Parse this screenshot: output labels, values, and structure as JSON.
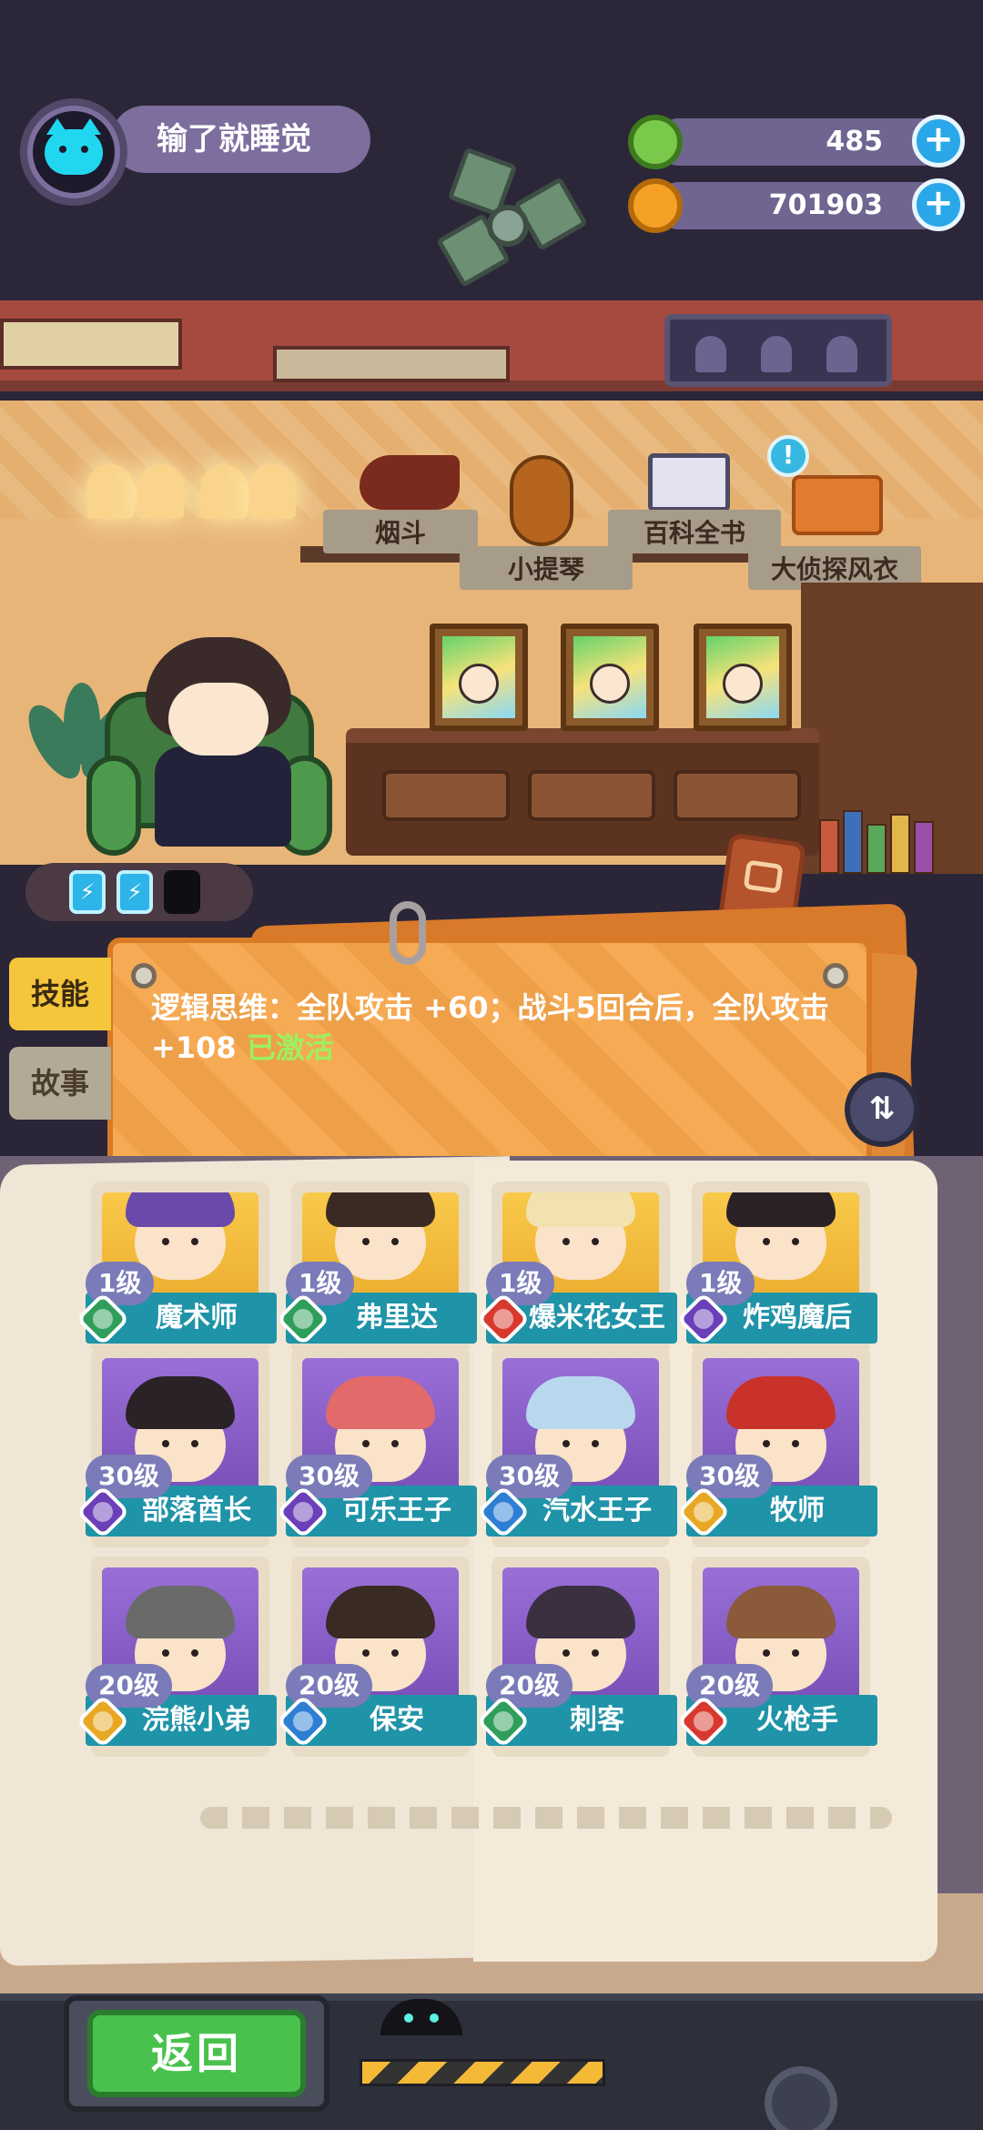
{
  "player": {
    "name": "输了就睡觉",
    "avatar_icon": "cyan-cat-icon"
  },
  "currencies": [
    {
      "name": "green-gem",
      "amount": "485",
      "icon": "green-coin-icon",
      "color": "#7bc94a"
    },
    {
      "name": "gold-coin",
      "amount": "701903",
      "icon": "planet-coin-icon",
      "color": "#f4a126"
    }
  ],
  "plus_symbol": "+",
  "room_items": {
    "pipe": "烟斗",
    "violin": "小提琴",
    "encyclopedia": "百科全书",
    "coat": "大侦探风衣",
    "alert": "!"
  },
  "energy": {
    "filled": 2,
    "total": 3
  },
  "side_tabs": {
    "skill": "技能",
    "story": "故事"
  },
  "skill": {
    "text": "逻辑思维：全队攻击 +60；战斗5回合后，全队攻击 +108",
    "status": "已激活"
  },
  "characters": [
    {
      "level": "1级",
      "name": "魔术师",
      "role_color": "#2f9e5a",
      "art": "gold",
      "hair": "#6a4aa8"
    },
    {
      "level": "1级",
      "name": "弗里达",
      "role_color": "#2f9e5a",
      "art": "gold",
      "hair": "#3a2a24"
    },
    {
      "level": "1级",
      "name": "爆米花女王",
      "role_color": "#d8392f",
      "art": "gold",
      "hair": "#f2e2b0"
    },
    {
      "level": "1级",
      "name": "炸鸡魔后",
      "role_color": "#6b3fb8",
      "art": "gold",
      "hair": "#2a2226"
    },
    {
      "level": "30级",
      "name": "部落酋长",
      "role_color": "#6b3fb8",
      "art": "purple",
      "hair": "#2a2226"
    },
    {
      "level": "30级",
      "name": "可乐王子",
      "role_color": "#6b3fb8",
      "art": "purple",
      "hair": "#e26a6a"
    },
    {
      "level": "30级",
      "name": "汽水王子",
      "role_color": "#2d7fd4",
      "art": "purple",
      "hair": "#b8d8ee"
    },
    {
      "level": "30级",
      "name": "牧师",
      "role_color": "#e8a824",
      "art": "purple",
      "hair": "#c8322a"
    },
    {
      "level": "20级",
      "name": "浣熊小弟",
      "role_color": "#e8a824",
      "art": "purple",
      "hair": "#6a6a6a"
    },
    {
      "level": "20级",
      "name": "保安",
      "role_color": "#2d7fd4",
      "art": "purple",
      "hair": "#3a2a24"
    },
    {
      "level": "20级",
      "name": "刺客",
      "role_color": "#2f9e5a",
      "art": "purple",
      "hair": "#3a3040"
    },
    {
      "level": "20级",
      "name": "火枪手",
      "role_color": "#d8392f",
      "art": "purple",
      "hair": "#8a5a3a"
    }
  ],
  "buttons": {
    "back": "返回",
    "swap": "⇅"
  }
}
